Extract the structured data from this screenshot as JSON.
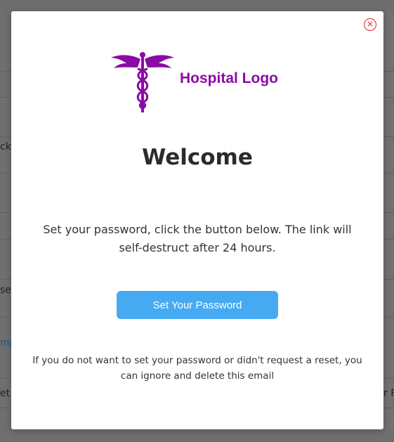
{
  "background": {
    "fragments": [
      "ck",
      "set",
      "mp",
      "et",
      "r F"
    ]
  },
  "modal": {
    "close_icon": "×",
    "logo": {
      "text": "Hospital Logo",
      "icon": "caduceus-icon",
      "color": "#8b0aa6"
    },
    "title": "Welcome",
    "message": "Set your password, click the button below. The link will self-destruct after 24 hours.",
    "button_label": "Set Your Password",
    "footnote": "If you do not want to set your password or didn't request a reset, you can ignore and delete this email"
  },
  "colors": {
    "accent": "#45aaf2",
    "close": "#e0242b"
  }
}
